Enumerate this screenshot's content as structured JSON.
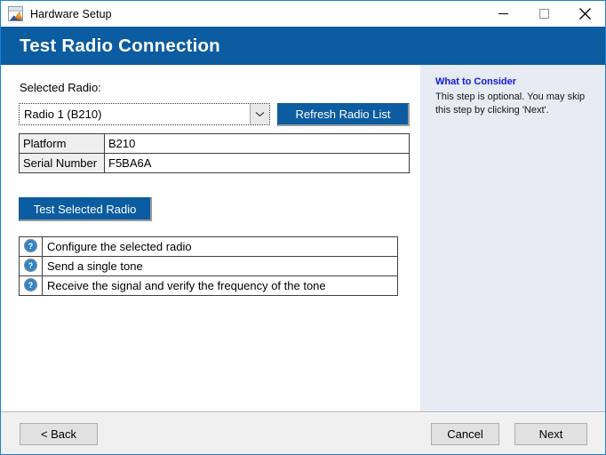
{
  "window": {
    "title": "Hardware Setup",
    "icon": "matlab-icon",
    "controls": {
      "minimize": "minimize-icon",
      "maximize": "maximize-icon",
      "close": "close-icon"
    },
    "accent_color": "#0b5ca0",
    "border_color": "#1883d7"
  },
  "banner": {
    "title": "Test Radio Connection"
  },
  "main": {
    "selected_radio_label": "Selected Radio:",
    "combo": {
      "value": "Radio 1 (B210)",
      "arrow_icon": "chevron-down-icon"
    },
    "refresh_button": "Refresh Radio List",
    "test_button": "Test Selected Radio",
    "info_table": {
      "rows": [
        {
          "key": "Platform",
          "value": "B210"
        },
        {
          "key": "Serial Number",
          "value": "F5BA6A"
        }
      ]
    },
    "steps": [
      {
        "icon": "help-icon",
        "text": "Configure the selected radio"
      },
      {
        "icon": "help-icon",
        "text": "Send a single tone"
      },
      {
        "icon": "help-icon",
        "text": "Receive the signal and verify the frequency of the tone"
      }
    ]
  },
  "side_panel": {
    "heading": "What to Consider",
    "text": "This step is optional. You may skip this step by clicking 'Next'.",
    "heading_color": "#0e19e0",
    "background_color": "#e7ebf3"
  },
  "footer": {
    "back": "< Back",
    "cancel": "Cancel",
    "next": "Next"
  }
}
